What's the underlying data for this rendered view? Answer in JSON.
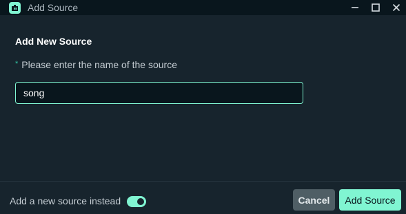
{
  "window": {
    "title": "Add Source",
    "controls": {
      "minimize_icon": "minimize-icon",
      "maximize_icon": "maximize-icon",
      "close_icon": "close-icon"
    }
  },
  "form": {
    "heading": "Add New Source",
    "required_mark": "*",
    "label": "Please enter the name of the source",
    "input_value": "song"
  },
  "footer": {
    "toggle_label": "Add a new source instead",
    "toggle_on": true,
    "cancel_label": "Cancel",
    "submit_label": "Add Source"
  },
  "colors": {
    "accent": "#80f5d2",
    "background": "#17242d",
    "titlebar": "#09161d",
    "cancel_button": "#4f5e65"
  }
}
